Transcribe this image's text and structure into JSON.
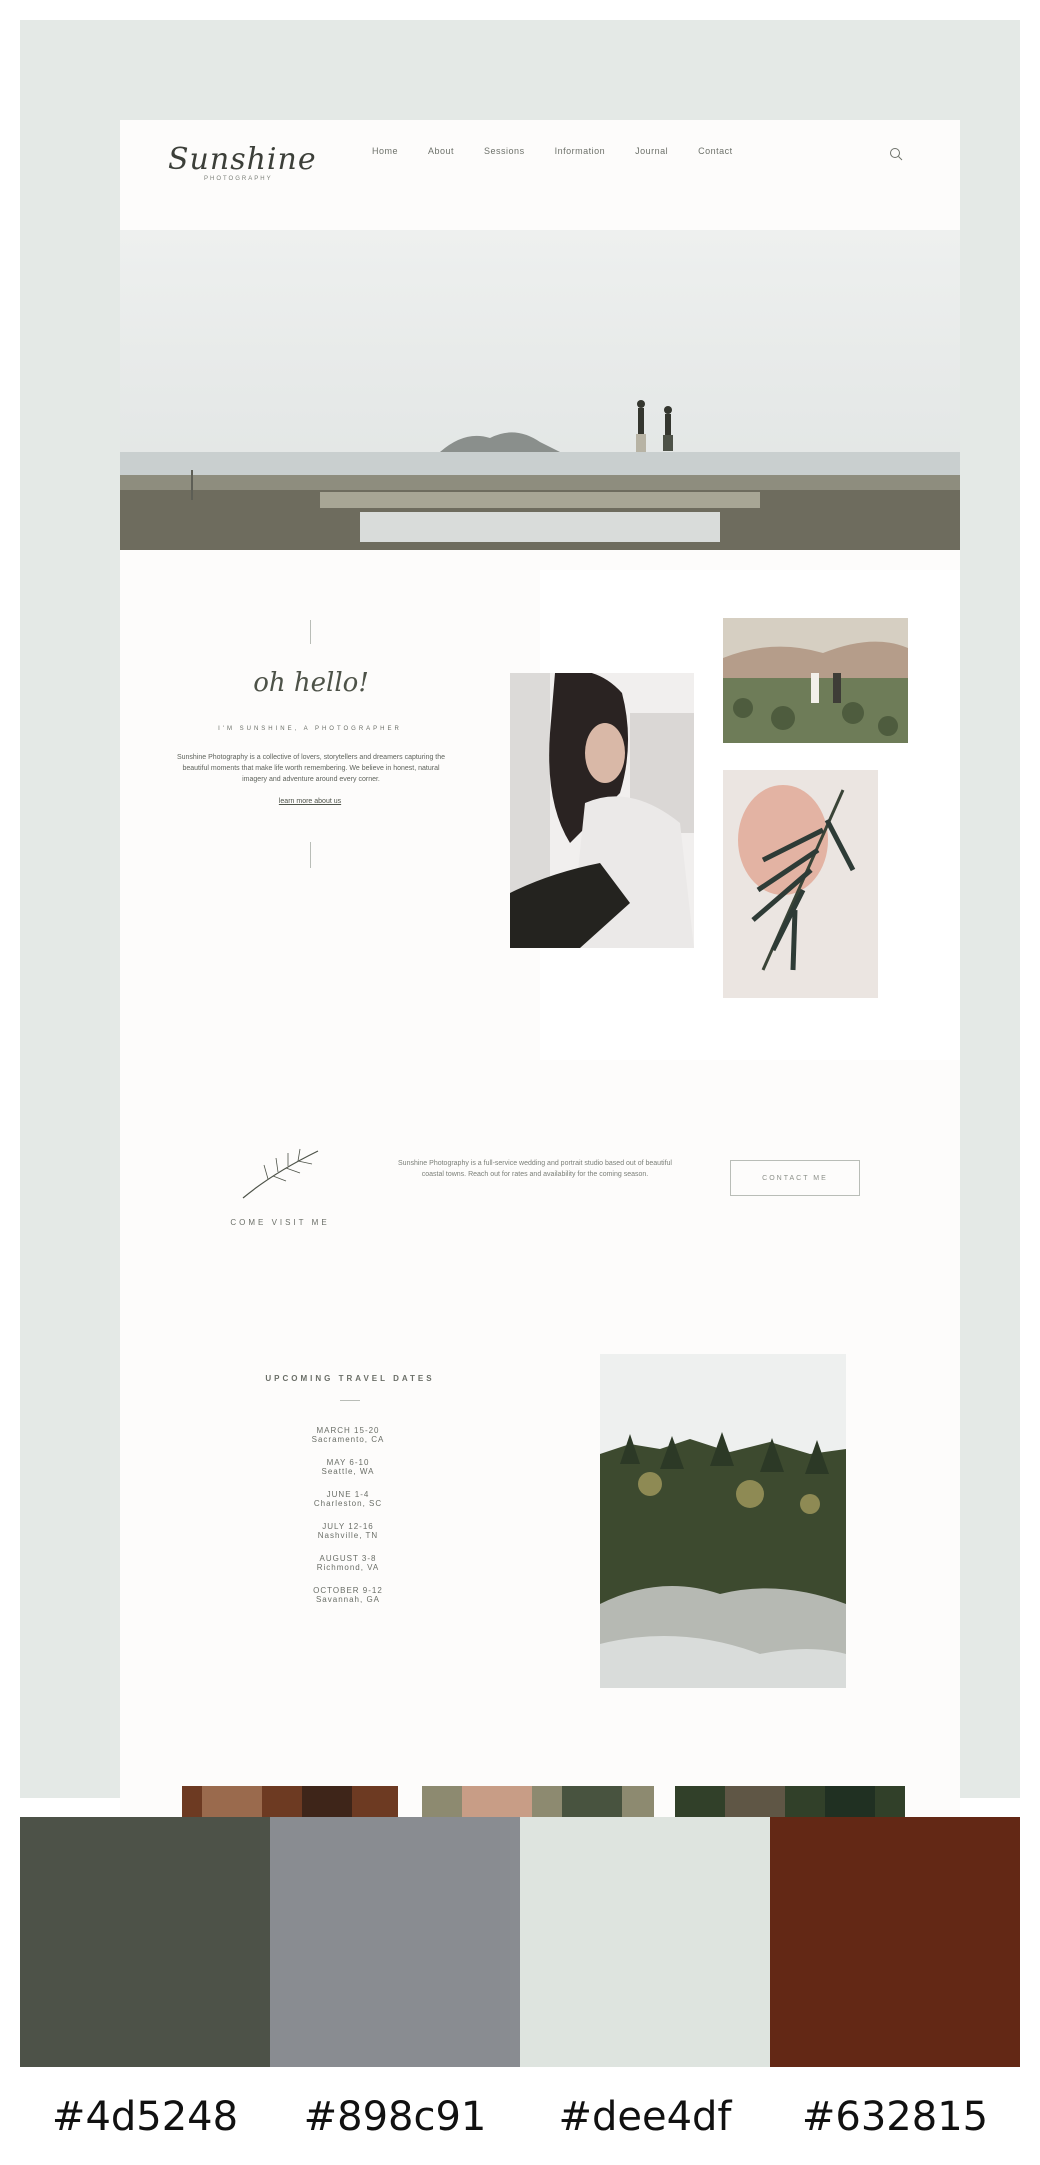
{
  "header": {
    "logo": "Sunshine",
    "logo_sub": "PHOTOGRAPHY",
    "nav": [
      "Home",
      "About",
      "Sessions",
      "Information",
      "Journal",
      "Contact"
    ]
  },
  "about": {
    "script_title": "oh hello!",
    "subtitle": "I'M SUNSHINE, A PHOTOGRAPHER",
    "body": "Sunshine Photography is a collective of lovers, storytellers and dreamers capturing the beautiful moments that make life worth remembering. We believe in honest, natural imagery and adventure around every corner.",
    "link": "learn more about us"
  },
  "cta": {
    "caption": "COME VISIT ME",
    "text": "Sunshine Photography is a full-service wedding and portrait studio based out of beautiful coastal towns. Reach out for rates and availability for the coming season.",
    "button": "CONTACT ME"
  },
  "travel": {
    "heading": "UPCOMING TRAVEL DATES",
    "dates": [
      {
        "d": "MARCH 15-20",
        "p": "Sacramento, CA"
      },
      {
        "d": "MAY 6-10",
        "p": "Seattle, WA"
      },
      {
        "d": "JUNE 1-4",
        "p": "Charleston, SC"
      },
      {
        "d": "JULY 12-16",
        "p": "Nashville, TN"
      },
      {
        "d": "AUGUST 3-8",
        "p": "Richmond, VA"
      },
      {
        "d": "OCTOBER 9-12",
        "p": "Savannah, GA"
      }
    ]
  },
  "palette": {
    "swatches": [
      {
        "color": "#4d5248",
        "label": "#4d5248"
      },
      {
        "color": "#898c91",
        "label": "#898c91"
      },
      {
        "color": "#dee4df",
        "label": "#dee4df"
      },
      {
        "color": "#632815",
        "label": "#632815"
      }
    ]
  }
}
